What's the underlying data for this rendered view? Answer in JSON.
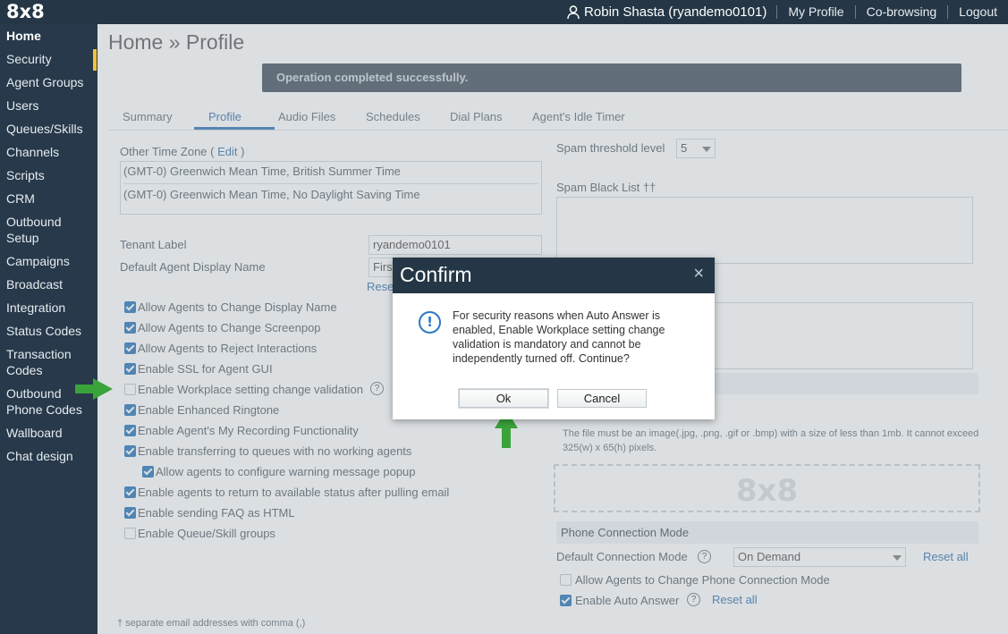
{
  "header": {
    "logo": "8x8",
    "user": "Robin Shasta (ryandemo0101)",
    "links": [
      "My Profile",
      "Co-browsing",
      "Logout"
    ]
  },
  "sidebar": {
    "items": [
      "Home",
      "Security",
      "Agent Groups",
      "Users",
      "Queues/Skills",
      "Channels",
      "Scripts",
      "CRM",
      "Outbound Setup",
      "Campaigns",
      "Broadcast",
      "Integration",
      "Status Codes",
      "Transaction Codes",
      "Outbound Phone Codes",
      "Wallboard",
      "Chat design"
    ],
    "wrapped": {
      "outbound_1": "Outbound",
      "outbound_2": "Setup",
      "transaction_1": "Transaction",
      "transaction_2": "Codes",
      "outphone_1": "Outbound",
      "outphone_2": "Phone Codes"
    }
  },
  "page": {
    "title": "Home » Profile",
    "alert": "Operation completed successfully."
  },
  "tabs": [
    "Summary",
    "Profile",
    "Audio Files",
    "Schedules",
    "Dial Plans",
    "Agent's Idle Timer"
  ],
  "left": {
    "other_tz_label": "Other Time Zone (",
    "other_tz_edit": "Edit",
    "other_tz_close": ")",
    "timezones": [
      "(GMT-0) Greenwich Mean Time, British Summer Time",
      "(GMT-0) Greenwich Mean Time, No Daylight Saving Time"
    ],
    "tenant_label": "Tenant Label",
    "tenant_value": "ryandemo0101",
    "display_name_label": "Default Agent Display Name",
    "display_name_value": "First",
    "reset": "Rese",
    "checkboxes": [
      {
        "label": "Allow Agents to Change Display Name",
        "checked": true
      },
      {
        "label": "Allow Agents to Change Screenpop",
        "checked": true
      },
      {
        "label": "Allow Agents to Reject Interactions",
        "checked": true
      },
      {
        "label": "Enable SSL for Agent GUI",
        "checked": true
      },
      {
        "label": "Enable Workplace setting change validation",
        "checked": false
      },
      {
        "label": "Enable Enhanced Ringtone",
        "checked": true
      },
      {
        "label": "Enable Agent's My Recording Functionality",
        "checked": true
      },
      {
        "label": "Enable transferring to queues with no working agents",
        "checked": true
      },
      {
        "label": "Allow agents to configure warning message popup",
        "checked": true
      },
      {
        "label": "Enable agents to return to available status after pulling email",
        "checked": true
      },
      {
        "label": "Enable sending FAQ as HTML",
        "checked": true
      },
      {
        "label": "Enable Queue/Skill groups",
        "checked": false
      }
    ],
    "footnote": "† separate email addresses with comma (,)"
  },
  "right": {
    "spam_threshold_label": "Spam threshold level",
    "spam_threshold_value": "5",
    "spam_blacklist_label": "Spam Black List ††",
    "logo_note": "The file must be an image(.jpg, .png, .gif or .bmp) with a size of less than 1mb. It cannot exceed 325(w) x 65(h) pixels.",
    "logo_placeholder": "8x8",
    "phone_section": "Phone Connection Mode",
    "default_conn_label": "Default Connection Mode",
    "default_conn_value": "On Demand",
    "reset_all": "Reset all",
    "allow_change_conn": "Allow Agents to Change Phone Connection Mode",
    "enable_auto_answer": "Enable Auto Answer"
  },
  "dialog": {
    "title": "Confirm",
    "close": "×",
    "icon": "!",
    "message": "For security reasons when Auto Answer is enabled, Enable Workplace setting change validation is mandatory and cannot be independently turned off. Continue?",
    "ok": "Ok",
    "cancel": "Cancel"
  },
  "colors": {
    "topbar": "#253746",
    "sidebar": "#27394a",
    "accent": "#f2c237",
    "link": "#2c6aa8",
    "arrow": "#3aa33a"
  }
}
